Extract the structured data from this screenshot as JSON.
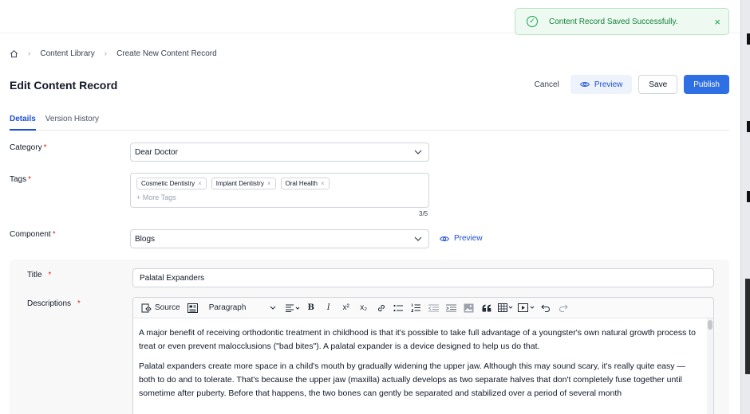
{
  "toast": {
    "message": "Content Record Saved Successfully.",
    "close": "×",
    "status_color": "#16a34a"
  },
  "breadcrumb": {
    "items": [
      "Content Library",
      "Create New Content Record"
    ],
    "separator": "›"
  },
  "page": {
    "title": "Edit Content Record"
  },
  "actions": {
    "cancel": "Cancel",
    "preview": "Preview",
    "save": "Save",
    "publish": "Publish",
    "accent": "#2f6fe4"
  },
  "tabs": [
    {
      "label": "Details",
      "active": true
    },
    {
      "label": "Version History",
      "active": false
    }
  ],
  "form": {
    "category": {
      "label": "Category",
      "required": "*",
      "value": "Dear Doctor"
    },
    "tags": {
      "label": "Tags",
      "required": "*",
      "items": [
        "Cosmetic Dentistry",
        "Implant Dentistry",
        "Oral Health"
      ],
      "remove": "×",
      "placeholder": "+ More Tags",
      "counter": "3/5"
    },
    "component": {
      "label": "Component",
      "required": "*",
      "value": "Blogs",
      "preview": "Preview"
    }
  },
  "panel": {
    "title_label": "Title",
    "title_required": "*",
    "title_value": "Palatal Expanders",
    "desc_label": "Descriptions",
    "desc_required": "*",
    "toolbar": {
      "source": "Source",
      "paragraph": "Paragraph",
      "bold": "B",
      "italic": "I",
      "superscript": "x²",
      "subscript": "x₂"
    },
    "paragraphs": [
      "A major benefit of receiving orthodontic treatment in childhood is that it's possible to take full advantage of a youngster's own natural growth process to treat or even prevent malocclusions (\"bad bites\"). A palatal expander is a device designed to help us do that.",
      "Palatal expanders create more space in a child's mouth by gradually widening the upper jaw. Although this may sound scary, it's really quite easy — both to do and to tolerate. That's because the upper jaw (maxilla) actually develops as two separate halves that don't completely fuse together until sometime after puberty. Before that happens, the two bones can gently be separated and stabilized over a period of several month"
    ]
  }
}
